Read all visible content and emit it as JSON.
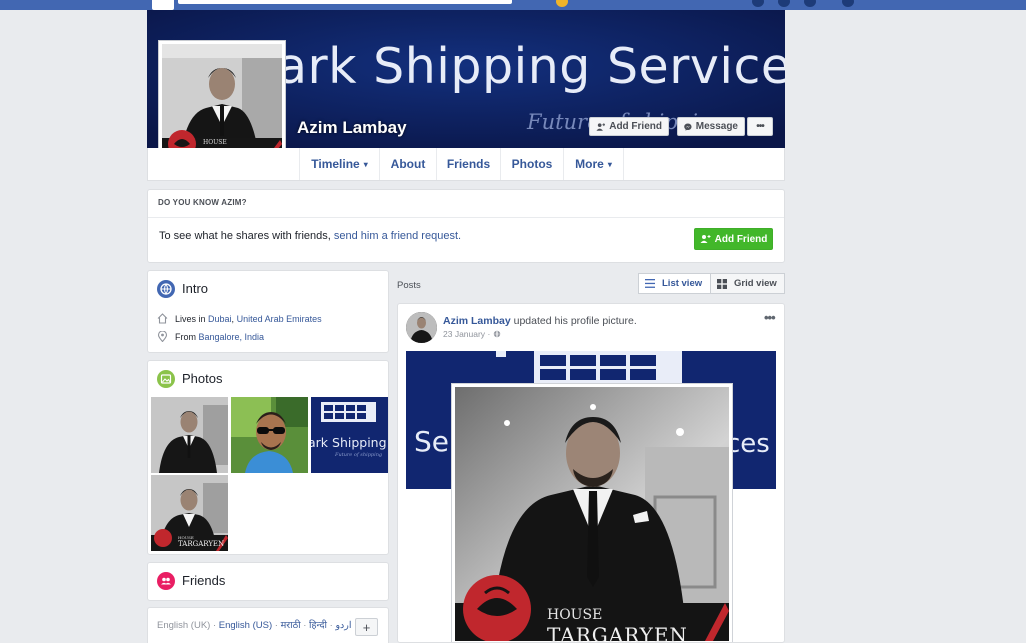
{
  "profile": {
    "name": "Azim Lambay",
    "cover_title": "ark Shipping Services",
    "cover_tagline": "Future of shipping",
    "house_label": "HOUSE",
    "house_name": "TARGARYEN"
  },
  "cover_buttons": {
    "add_friend": "Add Friend",
    "message": "Message",
    "more": "•••"
  },
  "nav": {
    "tabs": [
      {
        "label": "Timeline",
        "caret": "▾"
      },
      {
        "label": "About"
      },
      {
        "label": "Friends"
      },
      {
        "label": "Photos"
      },
      {
        "label": "More",
        "caret": "▾"
      }
    ]
  },
  "know": {
    "heading": "DO YOU KNOW AZIM?",
    "text": "To see what he shares with friends,",
    "link": "send him a friend request.",
    "button": "Add Friend"
  },
  "intro": {
    "title": "Intro",
    "lives_prefix": "Lives in",
    "lives_city": "Dubai",
    "lives_sep": ",",
    "lives_country": "United Arab Emirates",
    "from_prefix": "From",
    "from_place": "Bangalore, India"
  },
  "photos": {
    "title": "Photos",
    "mini_cover_text": "ark Shipping Se",
    "mini_cover_tagline": "Future of shipping"
  },
  "friends": {
    "title": "Friends"
  },
  "languages": {
    "items": [
      "English (UK)",
      "English (US)",
      "मराठी",
      "हिन्दी",
      "اردو"
    ],
    "sep": "·",
    "add": "+"
  },
  "posts": {
    "label": "Posts",
    "list_view": "List view",
    "grid_view": "Grid view",
    "post": {
      "author": "Azim Lambay",
      "action": "updated his profile picture.",
      "date": "23 January",
      "date_sep": "·",
      "more": "•••",
      "cover_text": "Se",
      "cover_text_right": "ces"
    }
  },
  "colors": {
    "fb_blue": "#4267b2",
    "link": "#365899",
    "green": "#42b72a",
    "cover_navy": "#0d1e5c",
    "house_red": "#c0272d"
  }
}
